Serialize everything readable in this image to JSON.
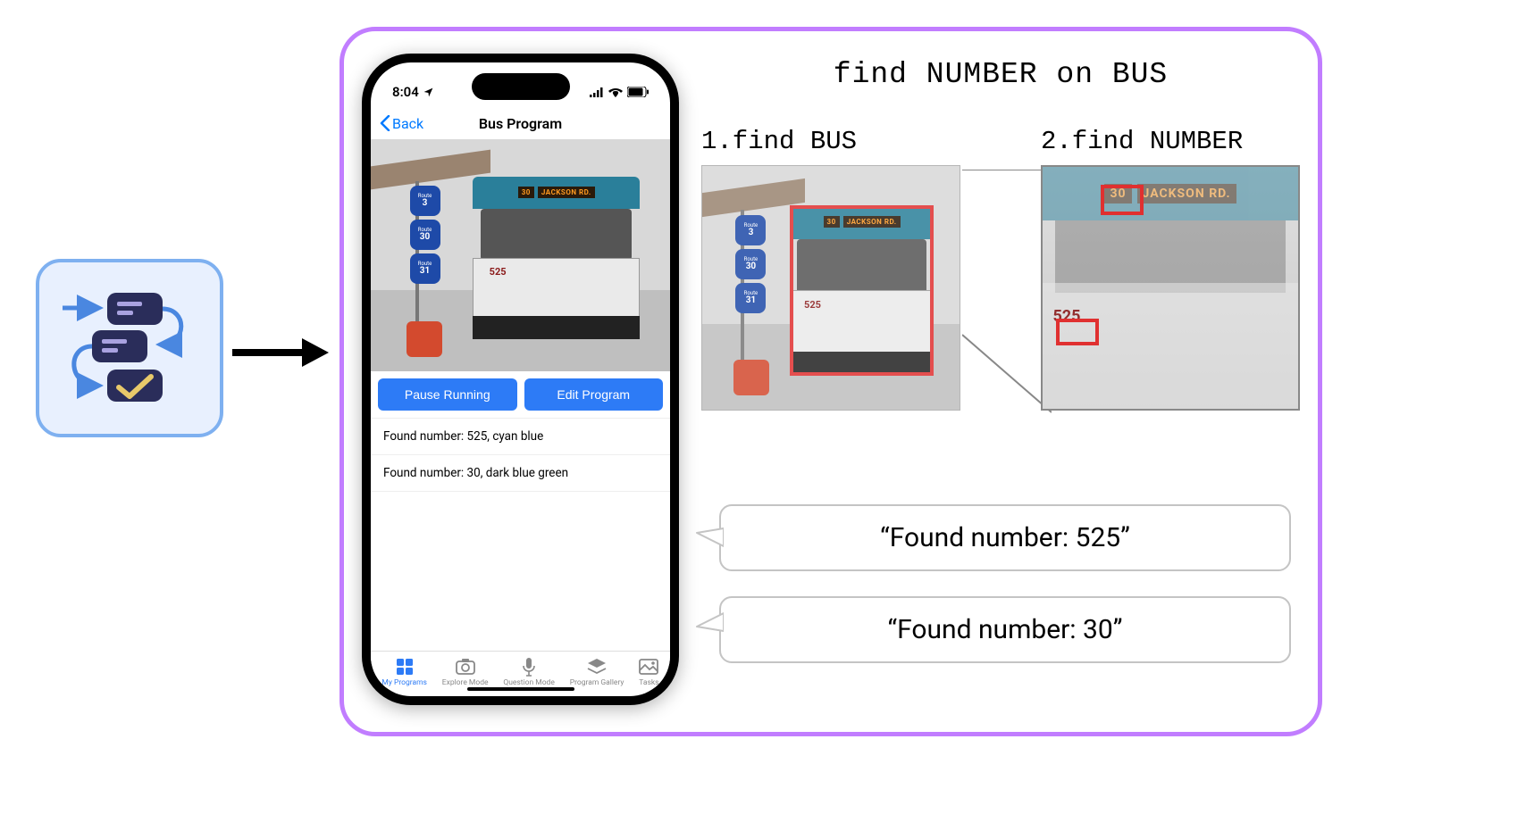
{
  "phone": {
    "status_time": "8:04",
    "nav_back": "Back",
    "nav_title": "Bus Program",
    "btn_pause": "Pause Running",
    "btn_edit": "Edit Program",
    "results": [
      "Found  number: 525, cyan blue",
      "Found  number: 30, dark blue green"
    ],
    "tabs": [
      {
        "label": "My Programs",
        "icon": "grid",
        "active": true
      },
      {
        "label": "Explore Mode",
        "icon": "camera",
        "active": false
      },
      {
        "label": "Question Mode",
        "icon": "mic",
        "active": false
      },
      {
        "label": "Program Gallery",
        "icon": "layers",
        "active": false
      },
      {
        "label": "Tasks",
        "icon": "image",
        "active": false
      }
    ],
    "photo": {
      "bus_led_number": "30",
      "bus_led_dest": "JACKSON RD.",
      "bus_body_number": "525",
      "route_signs": [
        "3",
        "30",
        "31"
      ],
      "route_prefix": "Route"
    }
  },
  "pipeline": {
    "rule": "find NUMBER on BUS",
    "step1_label": "1.find BUS",
    "step2_label": "2.find NUMBER",
    "bubbles": [
      "“Found number: 525”",
      "“Found number: 30”"
    ]
  }
}
